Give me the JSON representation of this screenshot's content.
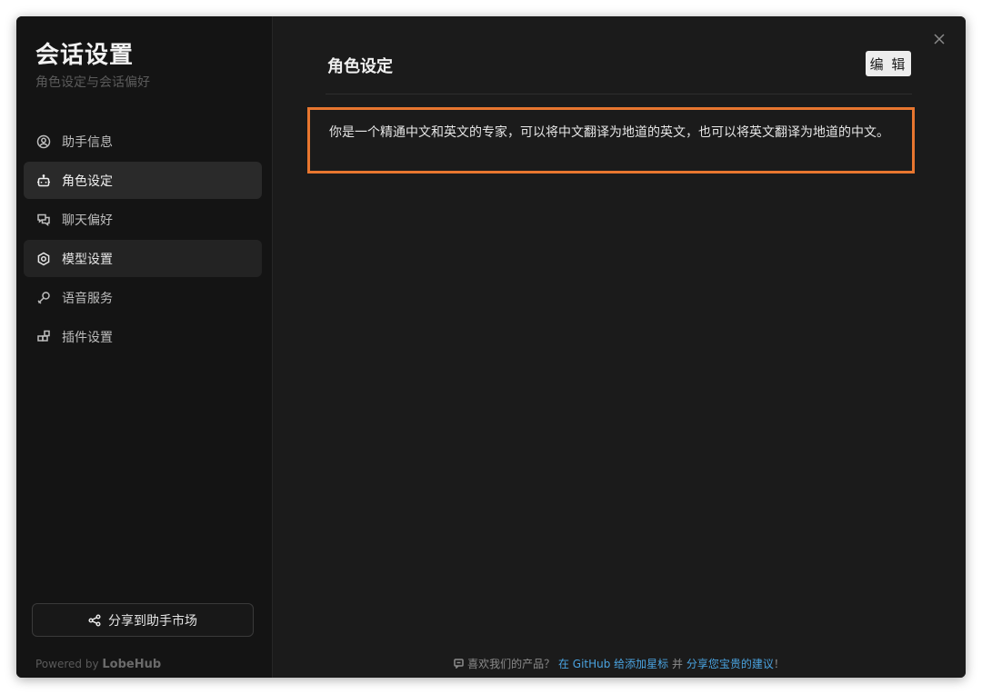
{
  "sidebar": {
    "title": "会话设置",
    "subtitle": "角色设定与会话偏好",
    "items": [
      {
        "label": "助手信息",
        "icon": "user-circle-icon"
      },
      {
        "label": "角色设定",
        "icon": "bot-icon"
      },
      {
        "label": "聊天偏好",
        "icon": "chat-bubbles-icon"
      },
      {
        "label": "模型设置",
        "icon": "model-settings-icon"
      },
      {
        "label": "语音服务",
        "icon": "mic-icon"
      },
      {
        "label": "插件设置",
        "icon": "blocks-icon"
      }
    ],
    "share_label": "分享到助手市场",
    "powered_prefix": "Powered by",
    "powered_brand": "LobeHub"
  },
  "main": {
    "section_title": "角色设定",
    "edit_label": "编 辑",
    "prompt_text": "你是一个精通中文和英文的专家，可以将中文翻译为地道的英文，也可以将英文翻译为地道的中文。"
  },
  "footer": {
    "prefix": "喜欢我们的产品？",
    "github_link": "在 GitHub 给添加星标",
    "and": " 并 ",
    "suggest_link": "分享您宝贵的建议",
    "suffix": "！"
  },
  "colors": {
    "accent_box": "#e8762f",
    "link": "#4aa3e0",
    "background": "#1b1b1b",
    "sidebar": "#141414"
  }
}
